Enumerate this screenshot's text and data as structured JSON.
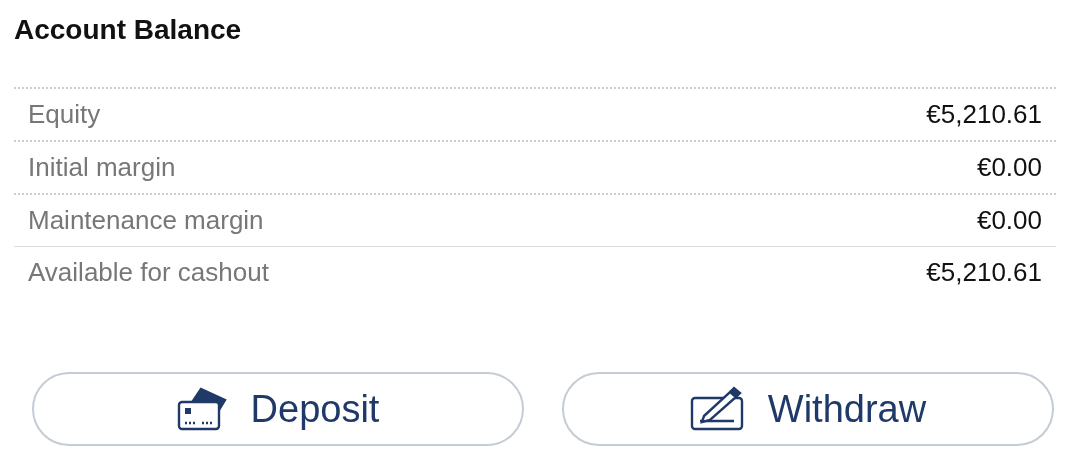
{
  "title": "Account Balance",
  "rows": [
    {
      "label": "Equity",
      "value": "€5,210.61",
      "dotted_divider": true
    },
    {
      "label": "Initial margin",
      "value": "€0.00",
      "dotted_divider": true
    },
    {
      "label": "Maintenance margin",
      "value": "€0.00",
      "dotted_divider": true
    },
    {
      "label": "Available for cashout",
      "value": "€5,210.61",
      "dotted_divider": false
    }
  ],
  "buttons": [
    {
      "label": "Deposit",
      "kind": "card"
    },
    {
      "label": "Withdraw",
      "kind": "cheque"
    }
  ]
}
